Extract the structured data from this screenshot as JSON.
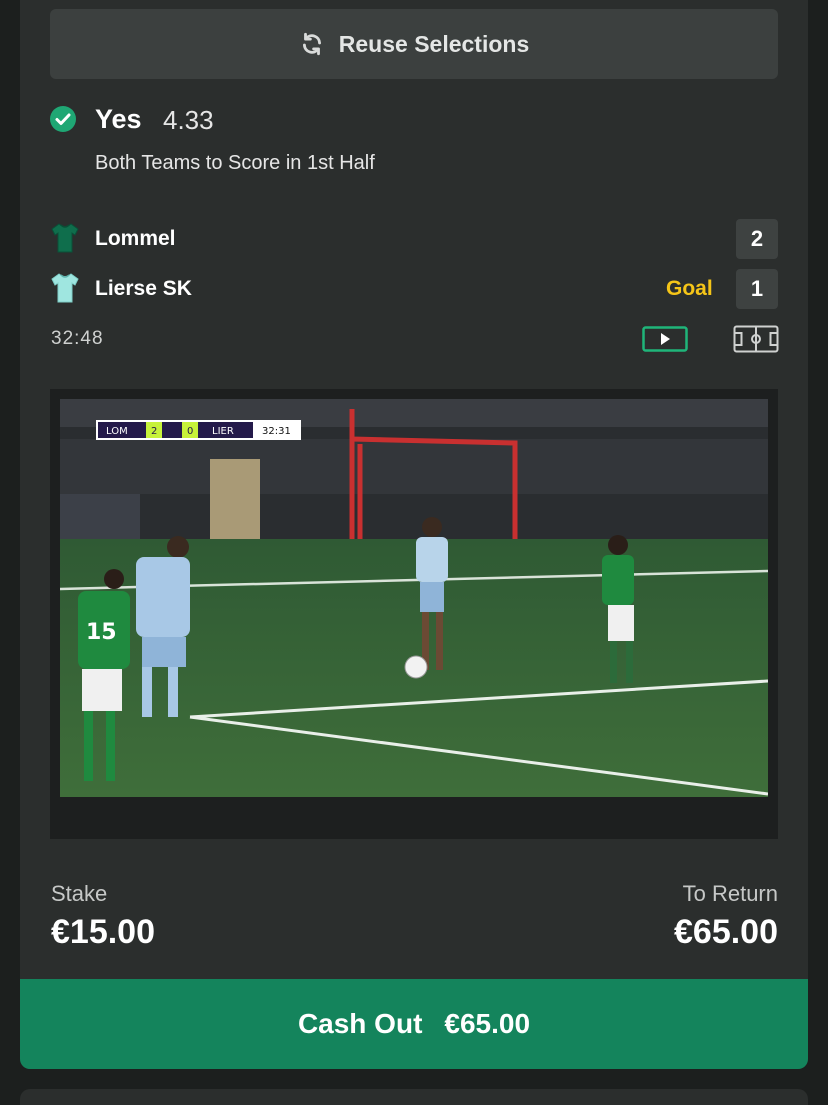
{
  "reuse_button": {
    "label": "Reuse Selections",
    "icon": "refresh-icon"
  },
  "selection": {
    "name": "Yes",
    "odds": "4.33",
    "market": "Both Teams to Score in 1st Half",
    "status_icon": "check-circle-icon",
    "status_color": "#1fa774"
  },
  "match": {
    "home": {
      "name": "Lommel",
      "score": "2",
      "shirt_color": "#0f6e4c"
    },
    "away": {
      "name": "Lierse SK",
      "score": "1",
      "shirt_color": "#9fe6e0",
      "event": "Goal"
    },
    "clock": "32:48",
    "live_stream_icon": "play-icon",
    "pitch_view_icon": "pitch-icon"
  },
  "video": {
    "scorebug": {
      "home_abbr": "LOM",
      "home_score": "2",
      "away_score": "0",
      "away_abbr": "LIER",
      "time": "32:31"
    },
    "shirt_number": "15"
  },
  "bet": {
    "stake_label": "Stake",
    "stake_value": "€15.00",
    "return_label": "To Return",
    "return_value": "€65.00"
  },
  "cashout": {
    "label": "Cash Out",
    "amount": "€65.00",
    "color": "#14845c"
  },
  "colors": {
    "background": "#1c1f1e",
    "card": "#2b2e2d",
    "goal": "#f5c518"
  }
}
